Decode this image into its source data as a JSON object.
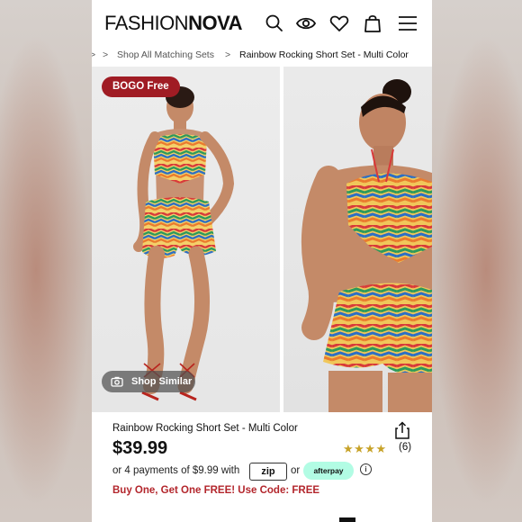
{
  "header": {
    "logo_part1": "FASHION",
    "logo_part2": "NOVA",
    "icons": [
      "search-icon",
      "eye-icon",
      "heart-icon",
      "bag-icon",
      "menu-icon"
    ]
  },
  "breadcrumb": {
    "separator": ">",
    "items": [
      "Shop All Matching Sets",
      "Rainbow Rocking Short Set - Multi Color"
    ]
  },
  "gallery": {
    "badge": "BOGO Free",
    "shop_similar": "Shop Similar"
  },
  "product": {
    "name": "Rainbow Rocking Short Set - Multi Color",
    "price": "$39.99",
    "stars": "★★★★",
    "rating_value": 4,
    "review_count": "(6)"
  },
  "payments": {
    "text": "or 4 payments of $9.99 with",
    "zip_label": "zip",
    "or": "or",
    "afterpay_label": "afterpay",
    "info": "i"
  },
  "promo": "Buy One, Get One FREE! Use Code: FREE",
  "colors": {
    "badge": "#a01c24",
    "promo": "#b3262c",
    "stars": "#c7a228",
    "afterpay": "#b2fce4"
  }
}
